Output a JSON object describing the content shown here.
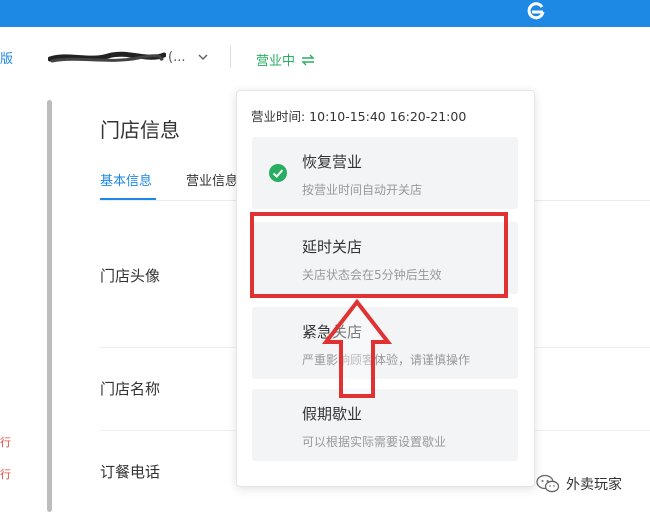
{
  "header": {
    "left_glyph": "版",
    "store_suffix": "(...",
    "status_label": "营业中"
  },
  "page": {
    "title": "门店信息",
    "tabs": [
      {
        "label": "基本信息",
        "active": true
      },
      {
        "label": "营业信息",
        "active": false
      }
    ],
    "fields": [
      "门店头像",
      "门店名称",
      "订餐电话"
    ]
  },
  "left_edge": {
    "red_glyphs": [
      "行",
      "行"
    ]
  },
  "dropdown": {
    "hours": "营业时间: 10:10-15:40 16:20-21:00",
    "options": [
      {
        "title": "恢复营业",
        "desc": "按营业时间自动开关店",
        "selected": true
      },
      {
        "title": "延时关店",
        "desc": "关店状态会在5分钟后生效",
        "selected": false
      },
      {
        "title": "紧急关店",
        "desc": "严重影响顾客体验，请谨慎操作",
        "selected": false
      },
      {
        "title": "假期歇业",
        "desc": "可以根据实际需要设置歇业",
        "selected": false
      }
    ]
  },
  "watermark": {
    "text": "外卖玩家"
  },
  "colors": {
    "brand_blue": "#1e88e5",
    "status_green": "#27ae60",
    "annotation_red": "#e03232"
  }
}
